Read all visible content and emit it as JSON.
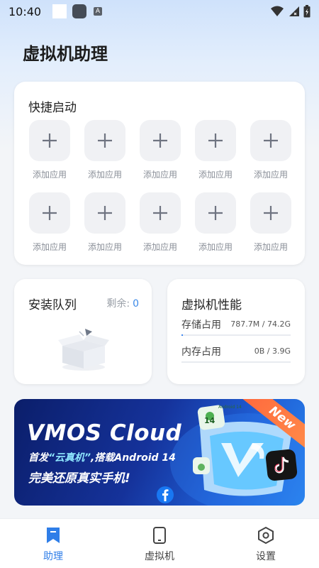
{
  "status_bar": {
    "time": "10:40",
    "a_glyph": "A"
  },
  "page": {
    "title": "虚拟机助理"
  },
  "quick_start": {
    "title": "快捷启动",
    "slots": [
      {
        "label": "添加应用"
      },
      {
        "label": "添加应用"
      },
      {
        "label": "添加应用"
      },
      {
        "label": "添加应用"
      },
      {
        "label": "添加应用"
      },
      {
        "label": "添加应用"
      },
      {
        "label": "添加应用"
      },
      {
        "label": "添加应用"
      },
      {
        "label": "添加应用"
      },
      {
        "label": "添加应用"
      }
    ]
  },
  "install_queue": {
    "title": "安装队列",
    "remaining_label": "剩余:",
    "remaining_count": "0"
  },
  "performance": {
    "title": "虚拟机性能",
    "storage_label": "存储占用",
    "storage_value": "787.7M / 74.2G",
    "storage_fraction": 0.0104,
    "memory_label": "内存占用",
    "memory_value": "0B / 3.9G",
    "memory_fraction": 0
  },
  "banner": {
    "title": "VMOS Cloud",
    "sub_prefix": "首发",
    "sub_highlight": "“云真机”",
    "sub_suffix": ",搭载Android 14",
    "sub2": "完美还原真实手机!",
    "ribbon": "New",
    "badge_text": "Android 14",
    "badge_number": "14"
  },
  "nav": [
    {
      "label": "助理",
      "icon": "bookmark-icon",
      "active": true
    },
    {
      "label": "虚拟机",
      "icon": "phone-icon",
      "active": false
    },
    {
      "label": "设置",
      "icon": "hexagon-settings-icon",
      "active": false
    }
  ],
  "colors": {
    "accent": "#2f7ee8",
    "count": "#3d8ae8",
    "ribbon": "#ff6a3d"
  }
}
